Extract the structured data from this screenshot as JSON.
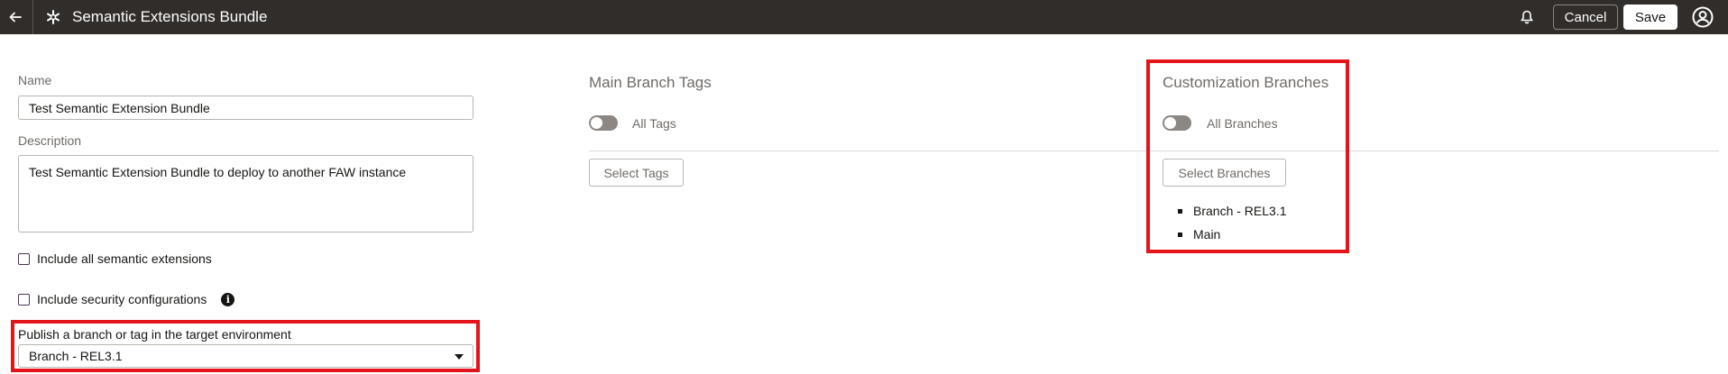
{
  "header": {
    "back_icon": "arrow-left-icon",
    "app_icon": "snowflake-icon",
    "title": "Semantic Extensions Bundle",
    "notifications_icon": "bell-icon",
    "cancel_label": "Cancel",
    "save_label": "Save",
    "user_icon": "user-avatar-icon"
  },
  "form": {
    "name_label": "Name",
    "name_value": "Test Semantic Extension Bundle",
    "description_label": "Description",
    "description_value": "Test Semantic Extension Bundle to deploy to another FAW instance",
    "include_all_label": "Include all semantic extensions",
    "include_security_label": "Include security configurations",
    "info_icon_glyph": "i",
    "publish_label": "Publish a branch or tag in the target environment",
    "publish_value": "Branch - REL3.1"
  },
  "main_branch_tags": {
    "title": "Main Branch Tags",
    "toggle_label": "All Tags",
    "toggle_on": false,
    "select_button": "Select Tags"
  },
  "customization_branches": {
    "title": "Customization Branches",
    "toggle_label": "All Branches",
    "toggle_on": false,
    "select_button": "Select Branches",
    "items": [
      "Branch - REL3.1",
      "Main"
    ]
  },
  "colors": {
    "header_bg": "#312d2a",
    "highlight": "#e4141b"
  }
}
